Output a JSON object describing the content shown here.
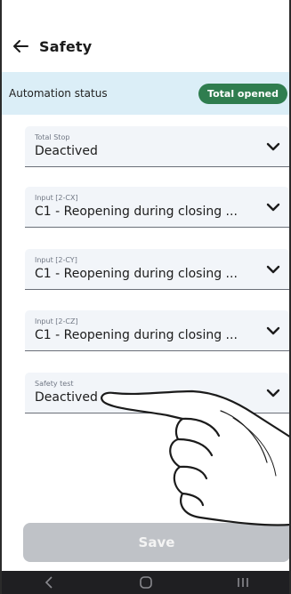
{
  "header": {
    "title": "Safety"
  },
  "status": {
    "label": "Automation status",
    "badge": "Total opened",
    "badge_color": "#2f7d4f",
    "background": "#dbeef7"
  },
  "fields": [
    {
      "caption": "Total Stop",
      "value": "Deactived"
    },
    {
      "caption": "Input [2-CX]",
      "value": "C1 - Reopening during closing ..."
    },
    {
      "caption": "Input [2-CY]",
      "value": "C1 - Reopening during closing ..."
    },
    {
      "caption": "Input [2-CZ]",
      "value": "C1 - Reopening during closing ..."
    },
    {
      "caption": "Safety test",
      "value": "Deactived"
    }
  ],
  "footer": {
    "save_label": "Save"
  },
  "icons": {
    "back": "arrow-left-icon",
    "dropdown": "chevron-down-icon",
    "nav": [
      "back-nav-icon",
      "home-nav-icon",
      "recent-apps-icon"
    ]
  }
}
